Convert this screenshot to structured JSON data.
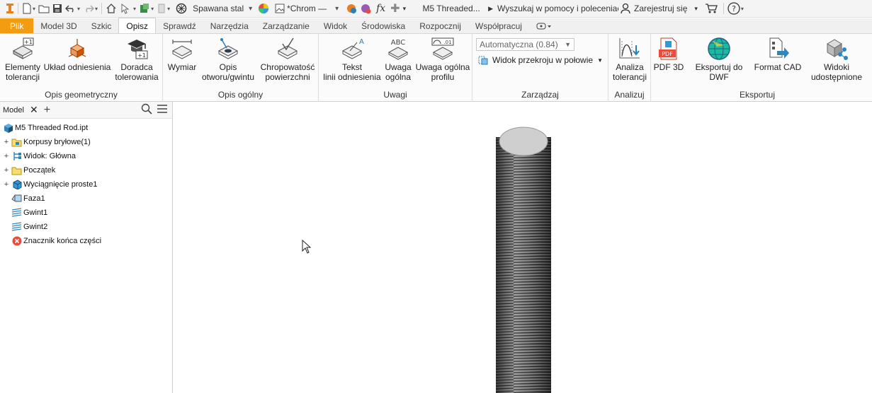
{
  "qat": {
    "material": "Spawana stal",
    "appearance": "*Chrom —",
    "fx": "fx",
    "doc_title": "M5 Threaded...",
    "search_placeholder": "Wyszukaj w pomocy i poleceniach",
    "sign_in": "Zarejestruj się"
  },
  "tabs": [
    "Plik",
    "Model 3D",
    "Szkic",
    "Opisz",
    "Sprawdź",
    "Narzędzia",
    "Zarządzanie",
    "Widok",
    "Środowiska",
    "Rozpocznij",
    "Współpracuj"
  ],
  "ribbon": {
    "geo": {
      "title": "Opis geometryczny",
      "b1": [
        "Elementy",
        "tolerancji"
      ],
      "b2": [
        "Układ odniesienia"
      ],
      "b3": [
        "Doradca",
        "tolerowania"
      ]
    },
    "gen": {
      "title": "Opis ogólny",
      "b1": [
        "Wymiar"
      ],
      "b2": [
        "Opis",
        "otworu/gwintu"
      ],
      "b3": [
        "Chropowatość",
        "powierzchni"
      ]
    },
    "notes": {
      "title": "Uwagi",
      "b1": [
        "Tekst",
        "linii odniesienia"
      ],
      "b2": [
        "Uwaga",
        "ogólna"
      ],
      "b3": [
        "Uwaga ogólna",
        "profilu"
      ]
    },
    "manage": {
      "title": "Zarządzaj",
      "dropdown_value": "Automatyczna (0.84)",
      "section": "Widok przekroju w połowie"
    },
    "analyze": {
      "title": "Analizuj",
      "b1": [
        "Analiza",
        "tolerancji"
      ]
    },
    "export": {
      "title": "Eksportuj",
      "b1": [
        "PDF 3D"
      ],
      "b2": [
        "Eksportuj do DWF"
      ],
      "b3": [
        "Format CAD"
      ],
      "b4": [
        "Widoki",
        "udostępnione"
      ]
    }
  },
  "browser": {
    "tab": "Model",
    "root": "M5 Threaded Rod.ipt",
    "items": [
      "Korpusy bryłowe(1)",
      "Widok: Główna",
      "Początek",
      "Wyciągnięcie proste1",
      "Faza1",
      "Gwint1",
      "Gwint2",
      "Znacznik końca części"
    ]
  }
}
